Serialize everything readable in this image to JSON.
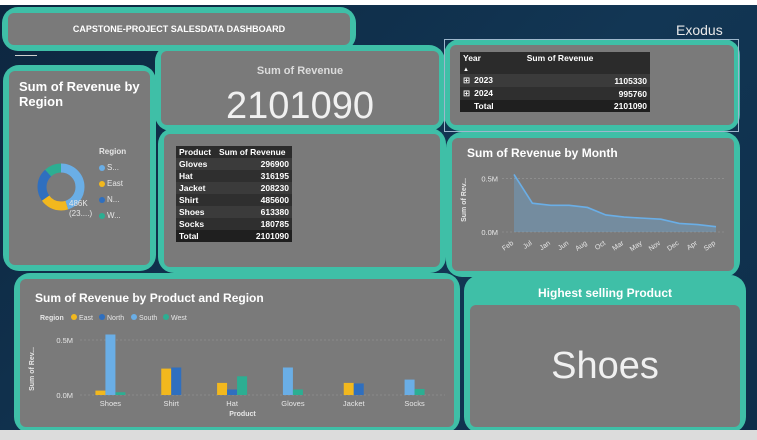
{
  "header": {
    "title": "CAPSTONE-PROJECT SALESDATA DASHBOARD",
    "brand": "Exodus"
  },
  "kpi": {
    "title": "Sum of Revenue",
    "value": "2101090"
  },
  "region_card": {
    "title": "Sum of Revenue by Region",
    "legend_title": "Region",
    "legend": [
      {
        "label": "S...",
        "color": "#6aaee6"
      },
      {
        "label": "East",
        "color": "#f2b81e"
      },
      {
        "label": "N...",
        "color": "#2f6fbf"
      },
      {
        "label": "W...",
        "color": "#2cae92"
      }
    ],
    "donut_values": [
      0.45,
      0.2,
      0.23,
      0.12
    ],
    "donut_label": "486K (23....)"
  },
  "year_table": {
    "headers": [
      "Year",
      "Sum of Revenue"
    ],
    "rows": [
      {
        "expand": "⊞",
        "year": "2023",
        "value": "1105330"
      },
      {
        "expand": "⊞",
        "year": "2024",
        "value": "995760"
      }
    ],
    "total": {
      "label": "Total",
      "value": "2101090"
    }
  },
  "product_table": {
    "headers": [
      "Product",
      "Sum of Revenue"
    ],
    "rows": [
      {
        "product": "Gloves",
        "value": "296900"
      },
      {
        "product": "Hat",
        "value": "316195"
      },
      {
        "product": "Jacket",
        "value": "208230"
      },
      {
        "product": "Shirt",
        "value": "485600"
      },
      {
        "product": "Shoes",
        "value": "613380"
      },
      {
        "product": "Socks",
        "value": "180785"
      }
    ],
    "total": {
      "label": "Total",
      "value": "2101090"
    }
  },
  "month_chart": {
    "title": "Sum of Revenue by Month",
    "ylabel": "Sum of Rev...",
    "yticks": [
      "0.5M",
      "0.0M"
    ]
  },
  "product_chart": {
    "title": "Sum of Revenue by Product and Region",
    "legend_title": "Region",
    "ylabel": "Sum of Rev...",
    "xlabel": "Product",
    "yticks": [
      "0.5M",
      "0.0M"
    ]
  },
  "highest": {
    "title": "Highest selling Product",
    "value": "Shoes"
  },
  "chart_data": [
    {
      "type": "area",
      "title": "Sum of Revenue by Month",
      "ylabel": "Sum of Rev...",
      "x": [
        "Feb",
        "Jul",
        "Jan",
        "Jun",
        "Aug",
        "Oct",
        "Mar",
        "May",
        "Nov",
        "Dec",
        "Apr",
        "Sep"
      ],
      "values": [
        540000,
        270000,
        250000,
        250000,
        230000,
        160000,
        140000,
        130000,
        120000,
        80000,
        70000,
        50000
      ],
      "ylim": [
        0,
        600000
      ],
      "color": "#6aaee6",
      "grid": true
    },
    {
      "type": "bar",
      "title": "Sum of Revenue by Product and Region",
      "xlabel": "Product",
      "ylabel": "Sum of Rev...",
      "categories": [
        "Shoes",
        "Shirt",
        "Hat",
        "Gloves",
        "Jacket",
        "Socks"
      ],
      "series": [
        {
          "name": "East",
          "color": "#f2b81e",
          "values": [
            40000,
            240000,
            110000,
            0,
            110000,
            0
          ]
        },
        {
          "name": "North",
          "color": "#2f6fbf",
          "values": [
            0,
            250000,
            50000,
            0,
            105000,
            0
          ]
        },
        {
          "name": "South",
          "color": "#6aaee6",
          "values": [
            550000,
            0,
            0,
            250000,
            0,
            140000
          ]
        },
        {
          "name": "West",
          "color": "#2cae92",
          "values": [
            25000,
            0,
            170000,
            50000,
            0,
            55000
          ]
        }
      ],
      "ylim": [
        0,
        600000
      ],
      "legend_position": "top-left"
    }
  ]
}
